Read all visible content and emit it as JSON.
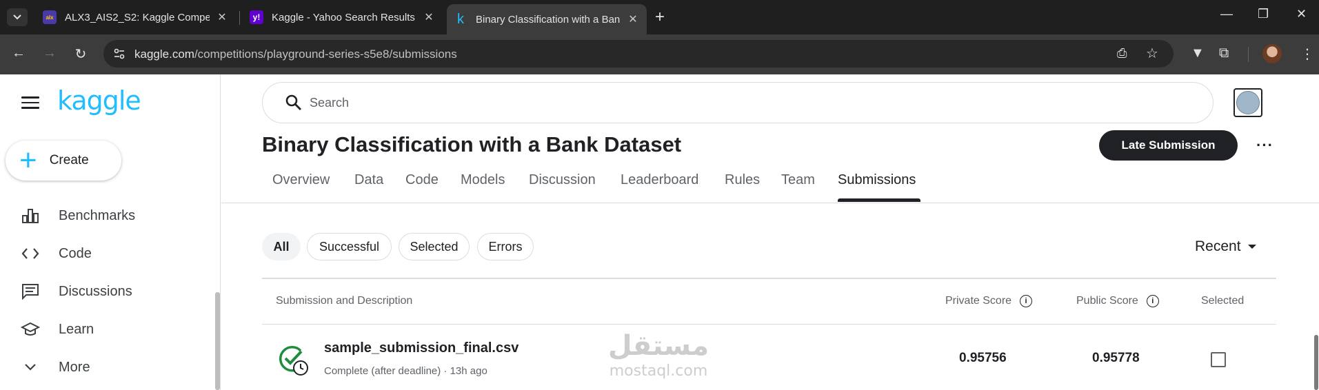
{
  "browser": {
    "tabs": [
      {
        "title": "ALX3_AIS2_S2: Kaggle Competiti",
        "active": false
      },
      {
        "title": "Kaggle - Yahoo Search Results",
        "active": false
      },
      {
        "title": "Binary Classification with a Bank",
        "active": true
      }
    ],
    "url_host": "kaggle.com",
    "url_path": "/competitions/playground-series-s5e8/submissions"
  },
  "sidebar": {
    "logo": "kaggle",
    "create_label": "Create",
    "items": [
      {
        "label": "Benchmarks",
        "icon": "bar-chart-icon"
      },
      {
        "label": "Code",
        "icon": "code-icon"
      },
      {
        "label": "Discussions",
        "icon": "discussion-icon"
      },
      {
        "label": "Learn",
        "icon": "school-icon"
      },
      {
        "label": "More",
        "icon": "chevron-down-icon"
      }
    ]
  },
  "header": {
    "search_placeholder": "Search"
  },
  "competition": {
    "title": "Binary Classification with a Bank Dataset",
    "late_submission_label": "Late Submission",
    "more_label": "···"
  },
  "nav_tabs": [
    "Overview",
    "Data",
    "Code",
    "Models",
    "Discussion",
    "Leaderboard",
    "Rules",
    "Team",
    "Submissions"
  ],
  "active_tab": "Submissions",
  "filters": {
    "chips": [
      "All",
      "Successful",
      "Selected",
      "Errors"
    ],
    "active": "All",
    "sort_label": "Recent"
  },
  "table": {
    "headers": {
      "submission": "Submission and Description",
      "private": "Private Score",
      "public": "Public Score",
      "selected": "Selected"
    },
    "rows": [
      {
        "file": "sample_submission_final.csv",
        "status": "Complete (after deadline) · 13h ago",
        "private_score": "0.95756",
        "public_score": "0.95778",
        "selected": false
      }
    ]
  },
  "watermark": {
    "arabic": "مستقل",
    "latin": "mostaql.com"
  },
  "colors": {
    "kaggle_blue": "#20beff",
    "success_green": "#1e8e3e",
    "dark": "#202124"
  }
}
